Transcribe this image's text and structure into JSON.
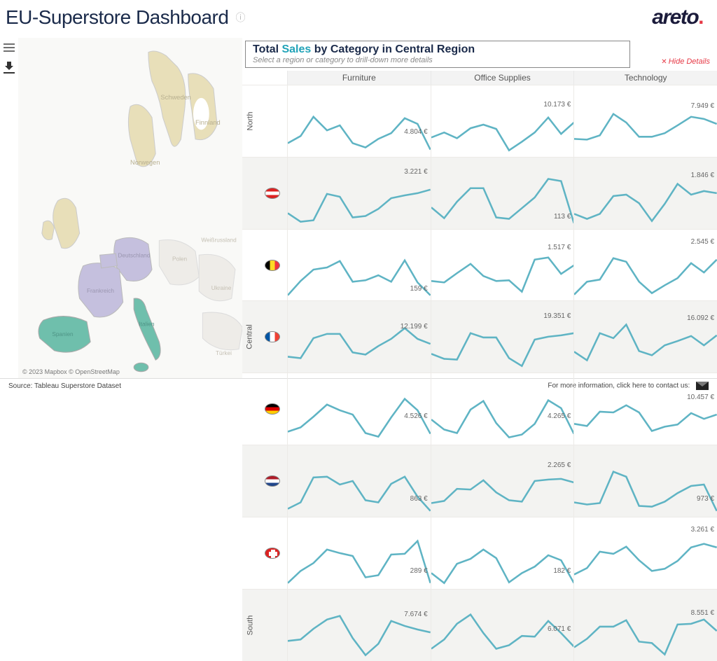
{
  "header": {
    "title": "EU-Superstore Dashboard",
    "logo_text": "areto",
    "logo_dot": "."
  },
  "chart": {
    "title_prefix": "Total ",
    "title_accent": "Sales",
    "title_suffix": " by Category in Central Region",
    "subtitle": "Select a region or category to drill-down more details",
    "hide_details": "Hide Details"
  },
  "columns": [
    "Furniture",
    "Office Supplies",
    "Technology"
  ],
  "region_labels": [
    "North",
    "Central",
    "South"
  ],
  "rows": [
    {
      "kind": "region",
      "label_idx": 0,
      "shade": false,
      "cells": [
        {
          "v": "4.804 €",
          "t": 60
        },
        {
          "v": "10.173 €",
          "t": 22
        },
        {
          "v": "7.949 €",
          "t": 24
        }
      ]
    },
    {
      "kind": "country",
      "flag": "at",
      "shade": true,
      "cells": [
        {
          "v": "3.221 €",
          "t": 15
        },
        {
          "v": "113 €",
          "t": 78
        },
        {
          "v": "1.846 €",
          "t": 20
        }
      ]
    },
    {
      "kind": "country",
      "flag": "be",
      "shade": false,
      "cells": [
        {
          "v": "159 €",
          "t": 78
        },
        {
          "v": "1.517 €",
          "t": 20
        },
        {
          "v": "2.545 €",
          "t": 12
        }
      ]
    },
    {
      "kind": "country",
      "flag": "fr",
      "shade": true,
      "cells": [
        {
          "v": "12.199 €",
          "t": 30
        },
        {
          "v": "19.351 €",
          "t": 15
        },
        {
          "v": "16.092 €",
          "t": 18
        }
      ]
    },
    {
      "kind": "country",
      "flag": "de",
      "shade": false,
      "cells": [
        {
          "v": "4.526 €",
          "t": 55
        },
        {
          "v": "4.265 €",
          "t": 55
        },
        {
          "v": "10.457 €",
          "t": 28
        }
      ]
    },
    {
      "kind": "country",
      "flag": "nl",
      "shade": true,
      "cells": [
        {
          "v": "863 €",
          "t": 70
        },
        {
          "v": "2.265 €",
          "t": 22
        },
        {
          "v": "973 €",
          "t": 70
        }
      ]
    },
    {
      "kind": "country",
      "flag": "ch",
      "shade": false,
      "cells": [
        {
          "v": "289 €",
          "t": 70
        },
        {
          "v": "182 €",
          "t": 70
        },
        {
          "v": "3.261 €",
          "t": 12
        }
      ]
    },
    {
      "kind": "region",
      "label_idx": 2,
      "shade": true,
      "cells": [
        {
          "v": "7.674 €",
          "t": 30
        },
        {
          "v": "6.071 €",
          "t": 50
        },
        {
          "v": "8.551 €",
          "t": 28
        }
      ]
    }
  ],
  "map": {
    "attribution": "© 2023 Mapbox  © OpenStreetMap",
    "labels": [
      "Schweden",
      "Finnland",
      "Norwegen",
      "Deutschland",
      "Frankreich",
      "Spanien",
      "Italien",
      "Polen",
      "Weißrussland",
      "Ukraine",
      "Türkei"
    ]
  },
  "footer": {
    "source": "Source: Tableau Superstore Dataset",
    "contact": "For more information, click here to contact us:"
  },
  "chart_data": {
    "type": "line",
    "note": "small-multiple sparklines; only final labeled value captured per cell (euros)",
    "columns": [
      "Furniture",
      "Office Supplies",
      "Technology"
    ],
    "rows": [
      {
        "label": "North",
        "values": [
          4804,
          10173,
          7949
        ]
      },
      {
        "label": "Austria",
        "values": [
          3221,
          113,
          1846
        ]
      },
      {
        "label": "Belgium",
        "values": [
          159,
          1517,
          2545
        ]
      },
      {
        "label": "France",
        "values": [
          12199,
          19351,
          16092
        ]
      },
      {
        "label": "Germany",
        "values": [
          4526,
          4265,
          10457
        ]
      },
      {
        "label": "Netherlands",
        "values": [
          863,
          2265,
          973
        ]
      },
      {
        "label": "Switzerland",
        "values": [
          289,
          182,
          3261
        ]
      },
      {
        "label": "South",
        "values": [
          7674,
          6071,
          8551
        ]
      }
    ]
  }
}
